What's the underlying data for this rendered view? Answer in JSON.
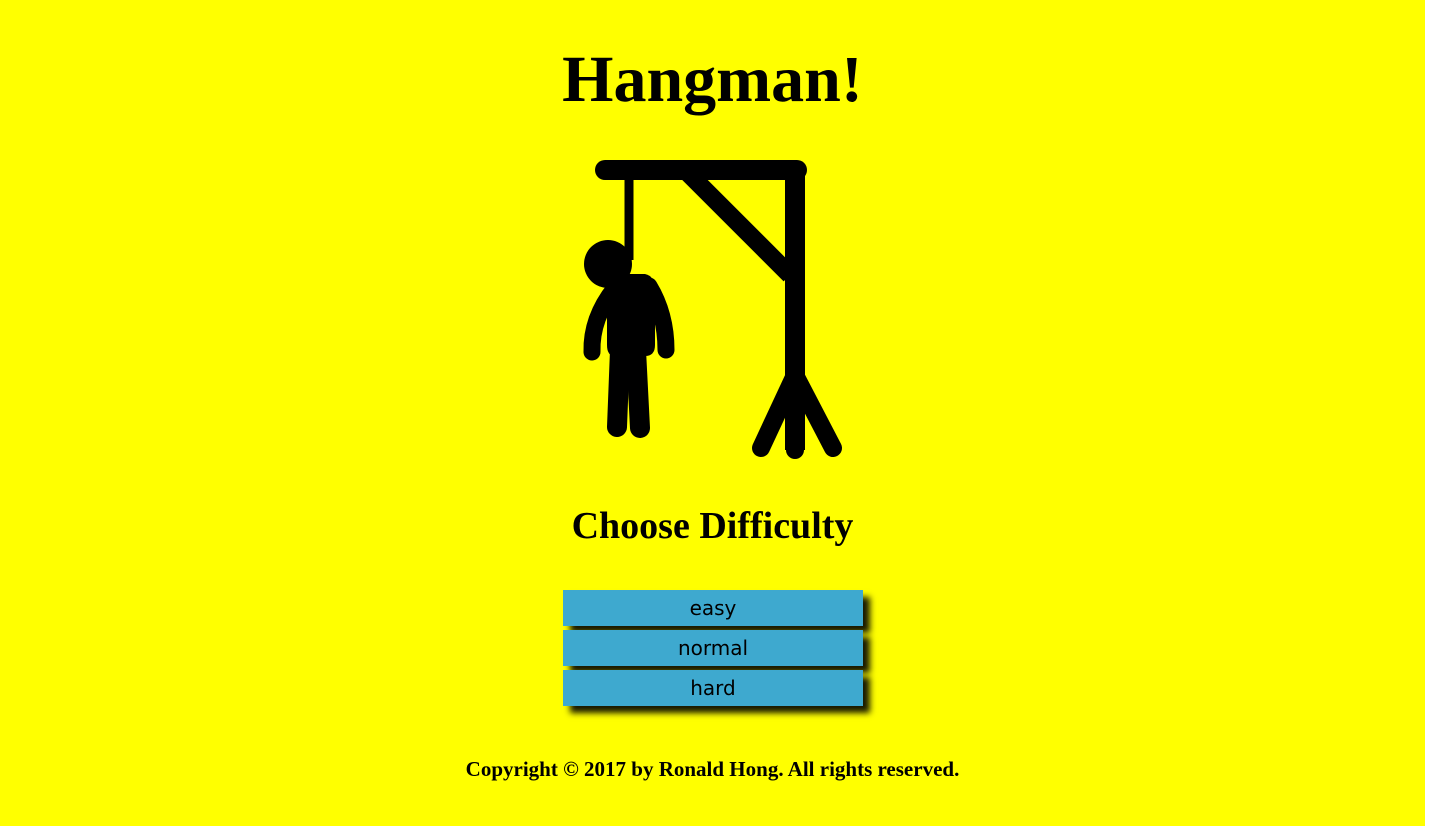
{
  "page": {
    "title": "Hangman!",
    "subtitle": "Choose Difficulty",
    "illustration_icon": "hanged-man-gallows-icon",
    "background_color": "#ffff00"
  },
  "difficulty": {
    "button_color": "#3ea9cf",
    "options": [
      {
        "label": "easy"
      },
      {
        "label": "normal"
      },
      {
        "label": "hard"
      }
    ]
  },
  "footer": {
    "copyright": "Copyright © 2017 by Ronald Hong. All rights reserved."
  }
}
